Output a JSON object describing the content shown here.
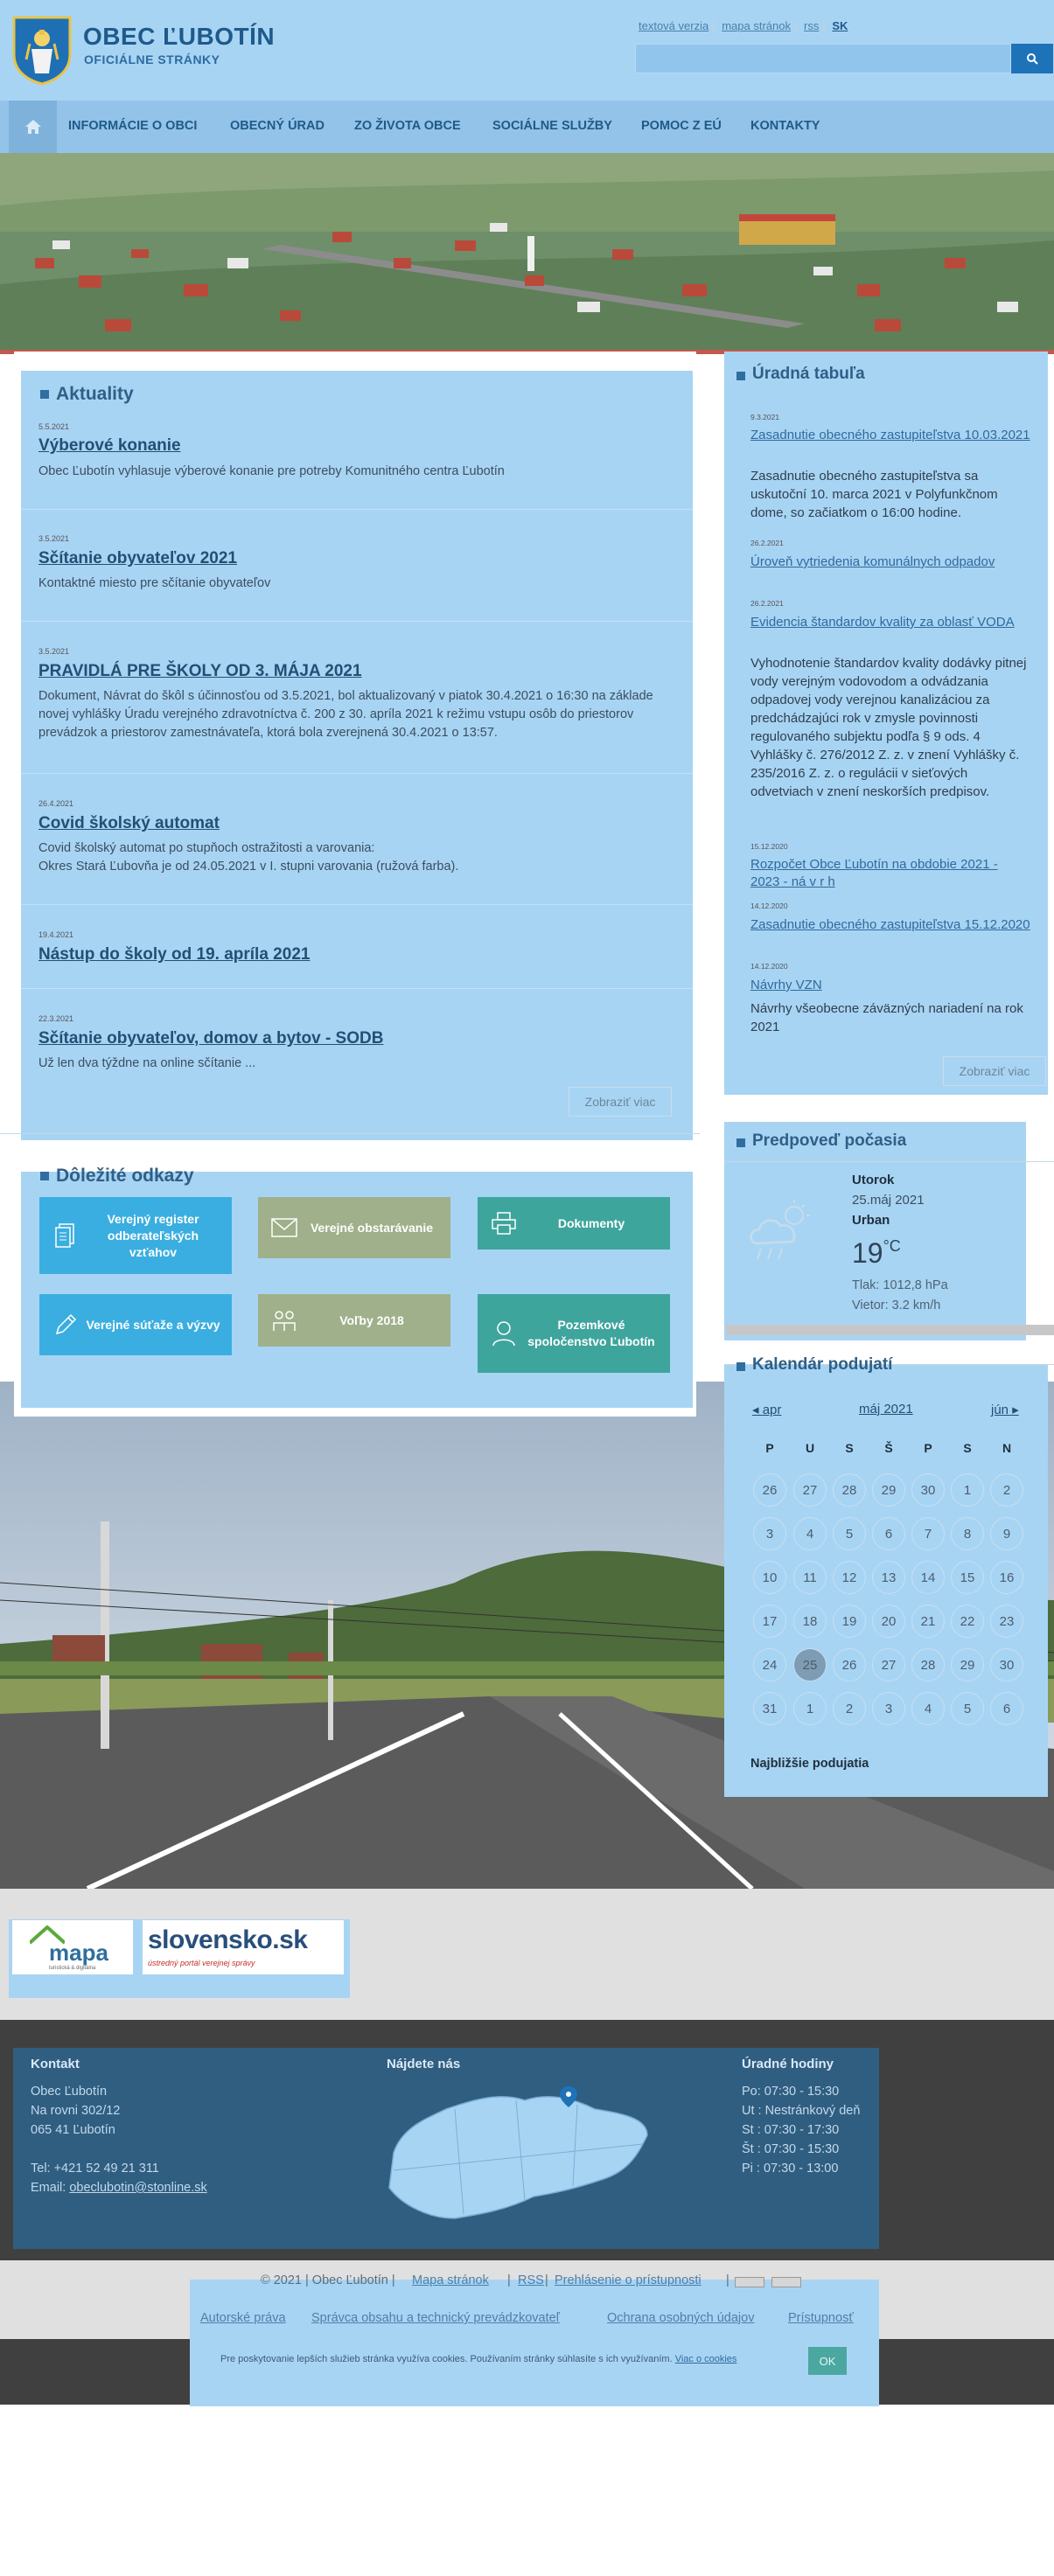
{
  "header": {
    "title": "OBEC ĽUBOTÍN",
    "subtitle": "OFICIÁLNE STRÁNKY",
    "toplinks": [
      "textová verzia",
      "mapa stránok",
      "rss",
      "SK"
    ]
  },
  "nav": {
    "items": [
      "INFORMÁCIE O OBCI",
      "OBECNÝ ÚRAD",
      "ZO ŽIVOTA OBCE",
      "SOCIÁLNE SLUŽBY",
      "POMOC Z EÚ",
      "KONTAKTY"
    ]
  },
  "news": {
    "title": "Aktuality",
    "more": "Zobraziť viac",
    "items": [
      {
        "date": "5.5.2021",
        "title": "Výberové konanie",
        "text": "Obec Ľubotín vyhlasuje výberové konanie pre potreby Komunitného centra Ľubotín"
      },
      {
        "date": "3.5.2021",
        "title": "Sčítanie obyvateľov 2021",
        "text": "Kontaktné miesto pre sčítanie obyvateľov"
      },
      {
        "date": "3.5.2021",
        "title": "PRAVIDLÁ PRE ŠKOLY OD 3. MÁJA 2021",
        "text": "Dokument, Návrat do škôl s účinnosťou od 3.5.2021, bol aktualizovaný v piatok 30.4.2021 o 16:30 na základe novej vyhlášky Úradu verejného zdravotníctva č. 200 z 30. apríla 2021 k režimu vstupu osôb do priestorov prevádzok a priestorov zamestnávateľa, ktorá bola zverejnená 30.4.2021 o 13:57."
      },
      {
        "date": "26.4.2021",
        "title": "Covid školský automat",
        "text": "Covid školský automat po stupňoch ostražitosti a varovania:",
        "text2": "Okres Stará Ľubovňa je od 24.05.2021 v I. stupni varovania (ružová farba)."
      },
      {
        "date": "19.4.2021",
        "title": "Nástup do školy od 19. apríla 2021",
        "text": ""
      },
      {
        "date": "22.3.2021",
        "title": "Sčítanie obyvateľov, domov a bytov - SODB",
        "text": "Už len dva týždne na online sčítanie ..."
      }
    ]
  },
  "links": {
    "title": "Dôležité odkazy",
    "tiles": [
      {
        "label": "Verejný register odberateľských vzťahov",
        "icon": "document-stack-icon",
        "color": "#3aaee0"
      },
      {
        "label": "Verejné obstarávanie",
        "icon": "envelope-icon",
        "color": "#9fb08a"
      },
      {
        "label": "Dokumenty",
        "icon": "printer-icon",
        "color": "#3ea59c"
      },
      {
        "label": "Verejné súťaže a výzvy",
        "icon": "pencil-icon",
        "color": "#3aaee0"
      },
      {
        "label": "Voľby 2018",
        "icon": "people-icon",
        "color": "#9fb08a"
      },
      {
        "label": "Pozemkové spoločenstvo Ľubotín",
        "icon": "user-icon",
        "color": "#3ea59c"
      }
    ]
  },
  "board": {
    "title": "Úradná tabuľa",
    "more": "Zobraziť viac",
    "items": [
      {
        "date": "9.3.2021",
        "title": "Zasadnutie obecného zastupiteľstva 10.03.2021",
        "text": "Zasadnutie obecného zastupiteľstva sa uskutoční 10. marca 2021 v Polyfunkčnom dome, so začiatkom o 16:00 hodine."
      },
      {
        "date": "26.2.2021",
        "title": "Úroveň vytriedenia komunálnych odpadov",
        "text": ""
      },
      {
        "date": "26.2.2021",
        "title": "Evidencia štandardov kvality za oblasť VODA",
        "text": "Vyhodnotenie štandardov kvality dodávky pitnej vody verejným vodovodom a odvádzania odpadovej vody verejnou kanalizáciou za predchádzajúci rok v zmysle povinnosti regulovaného subjektu podľa § 9 ods. 4 Vyhlášky č. 276/2012 Z. z. v znení Vyhlášky č. 235/2016 Z. z. o regulácii v sieťových odvetviach v znení neskorších predpisov."
      },
      {
        "date": "15.12.2020",
        "title": "Rozpočet Obce Ľubotín na obdobie 2021 - 2023 - ná v r h",
        "text": ""
      },
      {
        "date": "14.12.2020",
        "title": "Zasadnutie obecného zastupiteľstva 15.12.2020",
        "text": ""
      },
      {
        "date": "14.12.2020",
        "title": "Návrhy VZN",
        "text": "Návrhy všeobecne záväzných nariadení na rok 2021"
      }
    ]
  },
  "weather": {
    "title": "Predpoveď počasia",
    "day": "Utorok",
    "date": "25.máj 2021",
    "place": "Urban",
    "temp": "19",
    "unit": "°C",
    "pressure": "Tlak: 1012,8 hPa",
    "wind": "Vietor: 3.2 km/h"
  },
  "calendar": {
    "title": "Kalendár podujatí",
    "prev": "apr",
    "month": "máj 2021",
    "next": "jún",
    "dow": [
      "P",
      "U",
      "S",
      "Š",
      "P",
      "S",
      "N"
    ],
    "days": [
      "26",
      "27",
      "28",
      "29",
      "30",
      "1",
      "2",
      "3",
      "4",
      "5",
      "6",
      "7",
      "8",
      "9",
      "10",
      "11",
      "12",
      "13",
      "14",
      "15",
      "16",
      "17",
      "18",
      "19",
      "20",
      "21",
      "22",
      "23",
      "24",
      "25",
      "26",
      "27",
      "28",
      "29",
      "30",
      "31",
      "1",
      "2",
      "3",
      "4",
      "5",
      "6"
    ],
    "today": "25",
    "upcoming": "Najbližšie podujatia"
  },
  "partners": {
    "mapa_main": "mapa",
    "mapa_sub": "turistická & digitálna",
    "sk_main": "slovensko.sk",
    "sk_sub": "ústredný portál verejnej správy"
  },
  "footer": {
    "contact_title": "Kontakt",
    "contact_lines": [
      "Obec Ľubotín",
      "Na rovni 302/12",
      "065 41 Ľubotín",
      "",
      "Tel: +421 52 49 21 311"
    ],
    "email_label": "Email:",
    "email": "obeclubotin@stonline.sk",
    "find_title": "Nájdete nás",
    "hours_title": "Úradné hodiny",
    "hours": [
      "Po: 07:30 - 15:30",
      "Ut : Nestránkový deň",
      "St : 07:30 - 17:30",
      "Št : 07:30 - 15:30",
      "Pi : 07:30 - 13:00"
    ],
    "copyright": "© 2021 | Obec Ľubotín |",
    "links1": [
      "Mapa stránok",
      "RSS",
      "Prehlásenie o prístupnosti"
    ],
    "links2": [
      "Autorské práva",
      "Správca obsahu a technický prevádzkovateľ",
      "Ochrana osobných údajov",
      "Prístupnosť"
    ]
  },
  "cookie": {
    "text": "Pre poskytovanie lepších služieb stránka využíva cookies. Používaním stránky súhlasíte s ich využívaním.",
    "link": "Viac o cookies",
    "ok": "OK"
  },
  "colors": {
    "panel": "#a8d4f4",
    "brand": "#1e5a8a",
    "tile_blue": "#3aaee0",
    "tile_olive": "#9fb08a",
    "tile_teal": "#3ea59c"
  }
}
